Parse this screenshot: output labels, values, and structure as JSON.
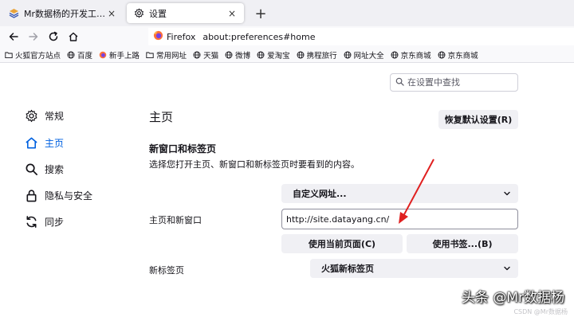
{
  "tabs": [
    {
      "title": "Mr数据杨的开发工程网址导航",
      "active": false,
      "close_label": "×"
    },
    {
      "title": "设置",
      "active": true,
      "close_label": "×"
    }
  ],
  "new_tab_label": "+",
  "urlbar": {
    "identity_label": "Firefox",
    "url": "about:preferences#home"
  },
  "bookmarks": [
    {
      "label": "火狐官方站点",
      "icon": "folder-icon"
    },
    {
      "label": "百度",
      "icon": "globe-icon"
    },
    {
      "label": "新手上路",
      "icon": "firefox-icon"
    },
    {
      "label": "常用网址",
      "icon": "folder-icon"
    },
    {
      "label": "天猫",
      "icon": "globe-icon"
    },
    {
      "label": "微博",
      "icon": "globe-icon"
    },
    {
      "label": "爱淘宝",
      "icon": "globe-icon"
    },
    {
      "label": "携程旅行",
      "icon": "globe-icon"
    },
    {
      "label": "网址大全",
      "icon": "globe-icon"
    },
    {
      "label": "京东商城",
      "icon": "globe-icon"
    },
    {
      "label": "京东商城",
      "icon": "globe-icon"
    }
  ],
  "search": {
    "placeholder": "在设置中查找"
  },
  "categories": [
    {
      "label": "常规",
      "icon": "gear-icon",
      "selected": false
    },
    {
      "label": "主页",
      "icon": "home-icon",
      "selected": true
    },
    {
      "label": "搜索",
      "icon": "search-icon",
      "selected": false
    },
    {
      "label": "隐私与安全",
      "icon": "lock-icon",
      "selected": false
    },
    {
      "label": "同步",
      "icon": "sync-icon",
      "selected": false
    }
  ],
  "home": {
    "title": "主页",
    "restore_button": "恢复默认设置(R)",
    "section_title": "新窗口和标签页",
    "section_desc": "选择您打开主页、新窗口和新标签页时要看到的内容。",
    "homepage_mode": "自定义网址...",
    "homepage_label": "主页和新窗口",
    "homepage_url": "http://site.datayang.cn/",
    "use_current_button": "使用当前页面(C)",
    "use_bookmark_button": "使用书签...(B)",
    "newtab_label": "新标签页",
    "newtab_value": "火狐新标签页"
  },
  "colors": {
    "accent": "#0061e0",
    "annotation_arrow": "#e02020",
    "button_bg": "#f0f0f4"
  },
  "watermark": {
    "text": "头条 @Mr数据杨",
    "sub": "CSDN @Mr数据杨"
  }
}
